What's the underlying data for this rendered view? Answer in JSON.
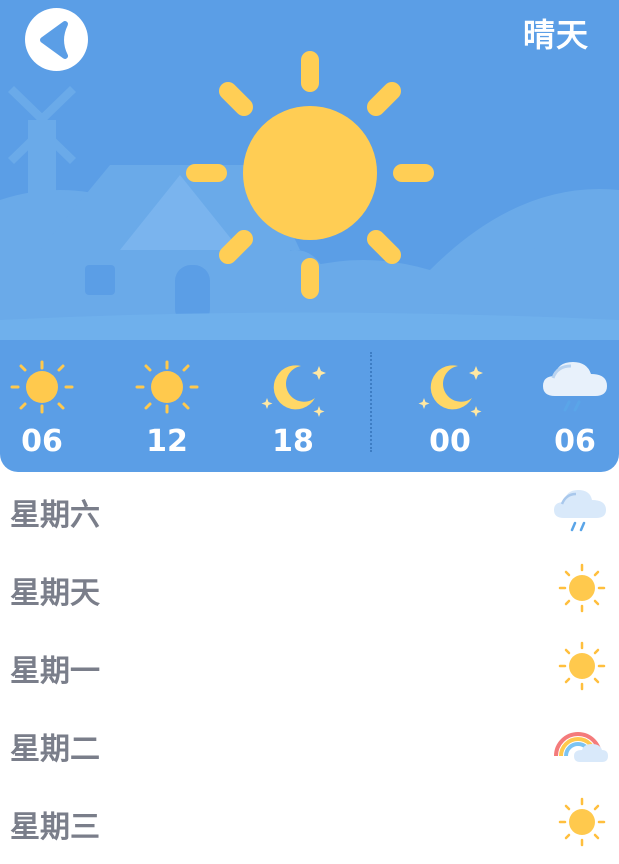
{
  "header": {
    "back_icon": "chevron-left-icon",
    "condition": "晴天",
    "main_icon": "sun-icon"
  },
  "hourly": [
    {
      "time": "06",
      "icon": "sun-icon"
    },
    {
      "time": "12",
      "icon": "sun-icon"
    },
    {
      "time": "18",
      "icon": "moon-icon"
    },
    {
      "time": "00",
      "icon": "moon-icon"
    },
    {
      "time": "06",
      "icon": "rain-cloud-icon"
    }
  ],
  "daily": [
    {
      "day": "星期六",
      "icon": "rain-cloud-icon"
    },
    {
      "day": "星期天",
      "icon": "sun-icon"
    },
    {
      "day": "星期一",
      "icon": "sun-icon"
    },
    {
      "day": "星期二",
      "icon": "rainbow-icon"
    },
    {
      "day": "星期三",
      "icon": "sun-icon"
    }
  ],
  "colors": {
    "sky": "#5b9ee6",
    "sun": "#ffc94d",
    "text_gray": "#7a7e8a"
  }
}
